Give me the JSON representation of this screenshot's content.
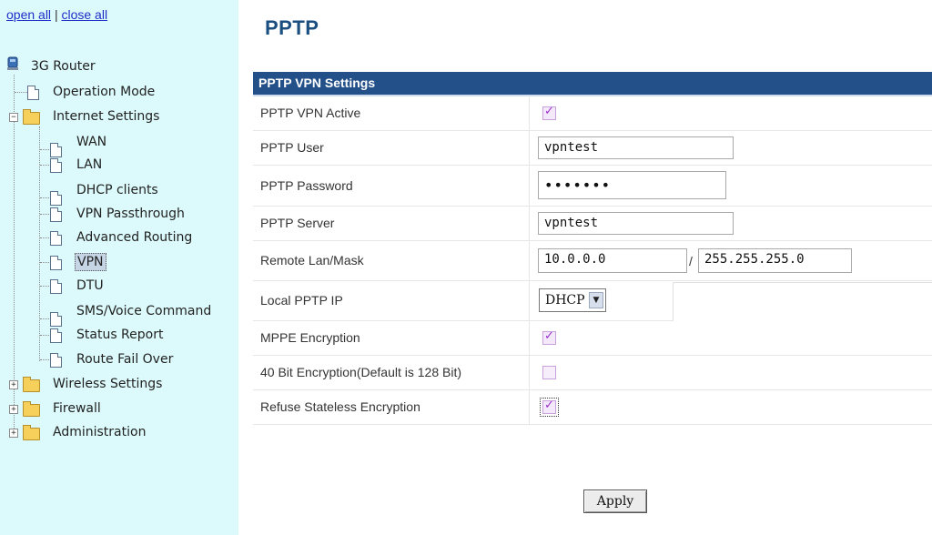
{
  "sidebar": {
    "open_all": "open all",
    "close_all": "close all",
    "separator": "|",
    "root": "3G Router",
    "items": [
      {
        "label": "Operation Mode",
        "type": "doc"
      },
      {
        "label": "Internet Settings",
        "type": "folder-open"
      },
      {
        "label": "WAN",
        "type": "doc"
      },
      {
        "label": "LAN",
        "type": "doc"
      },
      {
        "label": "DHCP clients",
        "type": "doc"
      },
      {
        "label": "VPN Passthrough",
        "type": "doc"
      },
      {
        "label": "Advanced Routing",
        "type": "doc"
      },
      {
        "label": "VPN",
        "type": "doc"
      },
      {
        "label": "DTU",
        "type": "doc"
      },
      {
        "label": "SMS/Voice Command",
        "type": "doc"
      },
      {
        "label": "Status Report",
        "type": "doc"
      },
      {
        "label": "Route Fail Over",
        "type": "doc"
      },
      {
        "label": "Wireless Settings",
        "type": "folder"
      },
      {
        "label": "Firewall",
        "type": "folder"
      },
      {
        "label": "Administration",
        "type": "folder"
      }
    ],
    "expand_symbol": "+",
    "collapse_symbol": "−"
  },
  "page": {
    "title": "PPTP",
    "table_header": "PPTP VPN Settings"
  },
  "rows": {
    "vpn_active": {
      "label": "PPTP VPN Active",
      "checked": true
    },
    "user": {
      "label": "PPTP User",
      "value": "vpntest"
    },
    "password": {
      "label": "PPTP Password",
      "value": "•••••••"
    },
    "server": {
      "label": "PPTP Server",
      "value": "vpntest"
    },
    "remote": {
      "label": "Remote Lan/Mask",
      "lan": "10.0.0.0",
      "slash": "/",
      "mask": "255.255.255.0"
    },
    "local_ip": {
      "label": "Local PPTP IP",
      "selected": "DHCP II"
    },
    "mppe": {
      "label": "MPPE Encryption",
      "checked": true
    },
    "bit40": {
      "label": "40 Bit Encryption(Default is 128 Bit)",
      "checked": false
    },
    "stateless": {
      "label": "Refuse Stateless Encryption",
      "checked": true
    }
  },
  "check_mark": "✓",
  "select_arrow": "▼",
  "apply_label": "Apply",
  "colors": {
    "sidebar_bg": "#dcfafb",
    "header_bg": "#24508a",
    "title": "#1b4f80",
    "link": "#1d2fc7"
  }
}
